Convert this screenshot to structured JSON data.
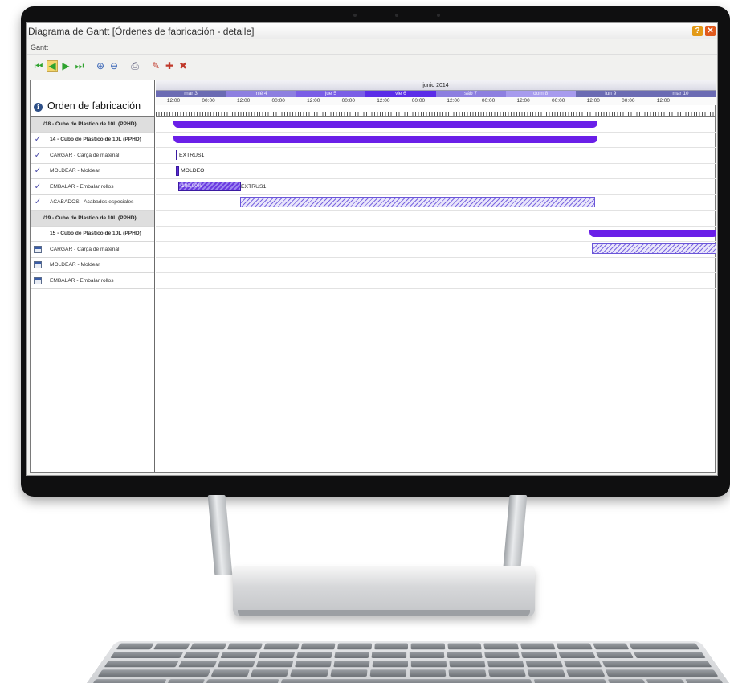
{
  "window": {
    "title": "Diagrama de Gantt [Órdenes de fabricación - detalle]",
    "help_label": "?",
    "close_label": "✕"
  },
  "menu": {
    "gantt_label": "Gantt"
  },
  "toolbar": {
    "icons": [
      "first-icon",
      "prev-icon",
      "next-icon",
      "last-icon",
      "zoom-in-icon",
      "zoom-out-icon",
      "print-icon",
      "mark-icon",
      "mark-add-icon",
      "mark-remove-icon"
    ]
  },
  "left": {
    "header": "Orden de fabricación",
    "rows": [
      {
        "label": "/18 - Cubo de Plastico de 10L (PPHD)",
        "type": "group",
        "status": "none"
      },
      {
        "label": "14 - Cubo de Plastico de 10L (PPHD)",
        "type": "order",
        "status": "done"
      },
      {
        "label": "CARGAR - Carga de material",
        "type": "op",
        "status": "done"
      },
      {
        "label": "MOLDEAR - Moldear",
        "type": "op",
        "status": "done"
      },
      {
        "label": "EMBALAR - Embalar rollos",
        "type": "op",
        "status": "done"
      },
      {
        "label": "ACABADOS - Acabados especiales",
        "type": "op",
        "status": "done"
      },
      {
        "label": "/19 - Cubo de Plastico de 10L (PPHD)",
        "type": "group",
        "status": "none"
      },
      {
        "label": "15 - Cubo de Plastico de 10L (PPHD)",
        "type": "order",
        "status": "none"
      },
      {
        "label": "CARGAR - Carga de material",
        "type": "op",
        "status": "calendar"
      },
      {
        "label": "MOLDEAR - Moldear",
        "type": "op",
        "status": "calendar"
      },
      {
        "label": "EMBALAR - Embalar rollos",
        "type": "op",
        "status": "calendar"
      }
    ]
  },
  "timeline": {
    "month": "junio 2014",
    "days": [
      {
        "label": "mar 3",
        "color": "#6b6bb3"
      },
      {
        "label": "mié 4",
        "color": "#8d7fe0"
      },
      {
        "label": "jue 5",
        "color": "#7a5ee6"
      },
      {
        "label": "vie 6",
        "color": "#5b2de8"
      },
      {
        "label": "sáb 7",
        "color": "#8d7fe0"
      },
      {
        "label": "dom 8",
        "color": "#a79bee"
      },
      {
        "label": "lun 9",
        "color": "#6b6bb3"
      },
      {
        "label": "mar 10",
        "color": "#6b6bb3"
      }
    ],
    "hours": [
      "12:00",
      "00:00",
      "12:00",
      "00:00",
      "12:00",
      "00:00",
      "12:00",
      "00:00",
      "12:00",
      "00:00",
      "12:00",
      "00:00",
      "12:00",
      "00:00",
      "12:00"
    ]
  },
  "bars": {
    "extrus_label_1": "EXTRUS1",
    "moldeo_label": "MOLDEO",
    "progress_pct": "100,00%",
    "extrus_label_2": "EXTRUS1"
  },
  "colors": {
    "summary": "#6a1fe8",
    "accent": "#5b2bd6",
    "check": "#4a4aa8"
  }
}
